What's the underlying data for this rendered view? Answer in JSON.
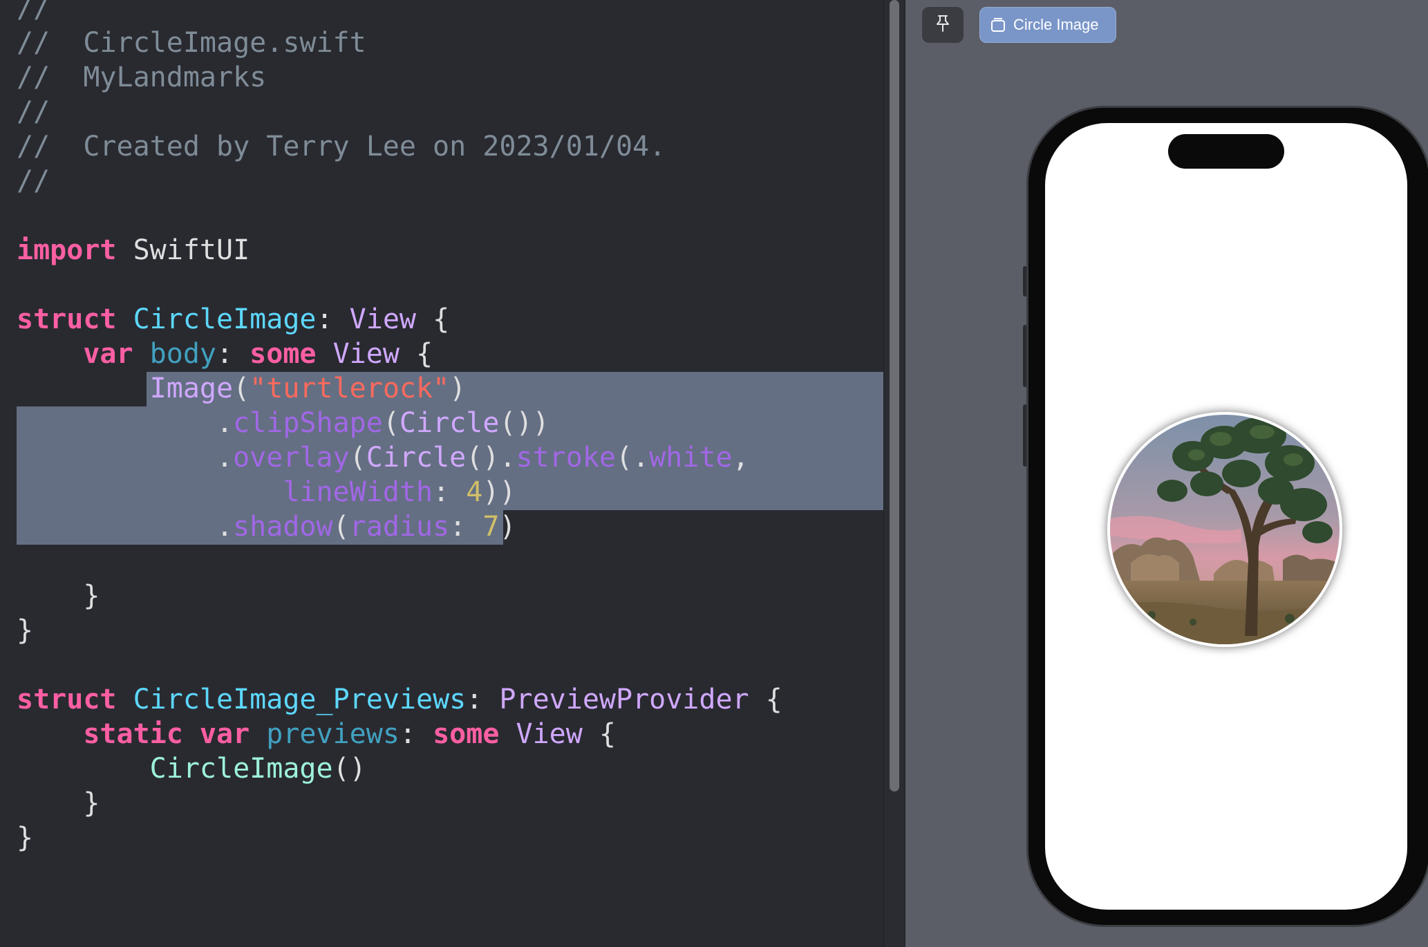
{
  "editor": {
    "lines": [
      [
        {
          "t": "//",
          "c": "comment"
        }
      ],
      [
        {
          "t": "//  CircleImage.swift",
          "c": "comment"
        }
      ],
      [
        {
          "t": "//  MyLandmarks",
          "c": "comment"
        }
      ],
      [
        {
          "t": "//",
          "c": "comment"
        }
      ],
      [
        {
          "t": "//  Created by Terry Lee on 2023/01/04.",
          "c": "comment"
        }
      ],
      [
        {
          "t": "//",
          "c": "comment"
        }
      ],
      [],
      [
        {
          "t": "import",
          "c": "kw"
        },
        {
          "t": " SwiftUI",
          "c": "plain"
        }
      ],
      [],
      [
        {
          "t": "struct",
          "c": "kw"
        },
        {
          "t": " ",
          "c": "plain"
        },
        {
          "t": "CircleImage",
          "c": "type"
        },
        {
          "t": ": ",
          "c": "plain"
        },
        {
          "t": "View",
          "c": "sys"
        },
        {
          "t": " {",
          "c": "plain"
        }
      ],
      [
        {
          "t": "    ",
          "c": "plain"
        },
        {
          "t": "var",
          "c": "kw"
        },
        {
          "t": " ",
          "c": "plain"
        },
        {
          "t": "body",
          "c": "decl"
        },
        {
          "t": ": ",
          "c": "plain"
        },
        {
          "t": "some",
          "c": "kw"
        },
        {
          "t": " ",
          "c": "plain"
        },
        {
          "t": "View",
          "c": "sys"
        },
        {
          "t": " {",
          "c": "plain"
        }
      ],
      [
        {
          "t": "        ",
          "c": "plain"
        },
        {
          "t": "Image",
          "c": "sys"
        },
        {
          "t": "(",
          "c": "plain"
        },
        {
          "t": "\"turtlerock\"",
          "c": "str"
        },
        {
          "t": ")",
          "c": "plain"
        }
      ],
      [
        {
          "t": "            .",
          "c": "plain"
        },
        {
          "t": "clipShape",
          "c": "call"
        },
        {
          "t": "(",
          "c": "plain"
        },
        {
          "t": "Circle",
          "c": "sys"
        },
        {
          "t": "())",
          "c": "plain"
        }
      ],
      [
        {
          "t": "            .",
          "c": "plain"
        },
        {
          "t": "overlay",
          "c": "call"
        },
        {
          "t": "(",
          "c": "plain"
        },
        {
          "t": "Circle",
          "c": "sys"
        },
        {
          "t": "().",
          "c": "plain"
        },
        {
          "t": "stroke",
          "c": "call"
        },
        {
          "t": "(.",
          "c": "plain"
        },
        {
          "t": "white",
          "c": "call"
        },
        {
          "t": ",",
          "c": "plain"
        }
      ],
      [
        {
          "t": "                ",
          "c": "plain"
        },
        {
          "t": "lineWidth",
          "c": "param"
        },
        {
          "t": ": ",
          "c": "plain"
        },
        {
          "t": "4",
          "c": "num"
        },
        {
          "t": "))",
          "c": "plain"
        }
      ],
      [
        {
          "t": "            .",
          "c": "plain"
        },
        {
          "t": "shadow",
          "c": "call"
        },
        {
          "t": "(",
          "c": "plain"
        },
        {
          "t": "radius",
          "c": "param"
        },
        {
          "t": ": ",
          "c": "plain"
        },
        {
          "t": "7",
          "c": "num"
        },
        {
          "t": ")",
          "c": "plain"
        }
      ],
      [],
      [
        {
          "t": "    }",
          "c": "plain"
        }
      ],
      [
        {
          "t": "}",
          "c": "plain"
        }
      ],
      [],
      [
        {
          "t": "struct",
          "c": "kw"
        },
        {
          "t": " ",
          "c": "plain"
        },
        {
          "t": "CircleImage_Previews",
          "c": "type"
        },
        {
          "t": ": ",
          "c": "plain"
        },
        {
          "t": "PreviewProvider",
          "c": "sys"
        },
        {
          "t": " {",
          "c": "plain"
        }
      ],
      [
        {
          "t": "    ",
          "c": "plain"
        },
        {
          "t": "static",
          "c": "kw"
        },
        {
          "t": " ",
          "c": "plain"
        },
        {
          "t": "var",
          "c": "kw"
        },
        {
          "t": " ",
          "c": "plain"
        },
        {
          "t": "previews",
          "c": "decl"
        },
        {
          "t": ": ",
          "c": "plain"
        },
        {
          "t": "some",
          "c": "kw"
        },
        {
          "t": " ",
          "c": "plain"
        },
        {
          "t": "View",
          "c": "sys"
        },
        {
          "t": " {",
          "c": "plain"
        }
      ],
      [
        {
          "t": "        ",
          "c": "plain"
        },
        {
          "t": "CircleImage",
          "c": "proj"
        },
        {
          "t": "()",
          "c": "plain"
        }
      ],
      [
        {
          "t": "    }",
          "c": "plain"
        }
      ],
      [
        {
          "t": "}",
          "c": "plain"
        }
      ]
    ]
  },
  "canvas": {
    "preview_label": "Circle Image",
    "pin_icon": "pin-icon",
    "preview_icon": "preview-window-icon"
  },
  "colors": {
    "editor_bg": "#292a30",
    "selection": "#646f83",
    "canvas_bg": "#5b5e66",
    "chip_accent": "#7a96c8"
  }
}
